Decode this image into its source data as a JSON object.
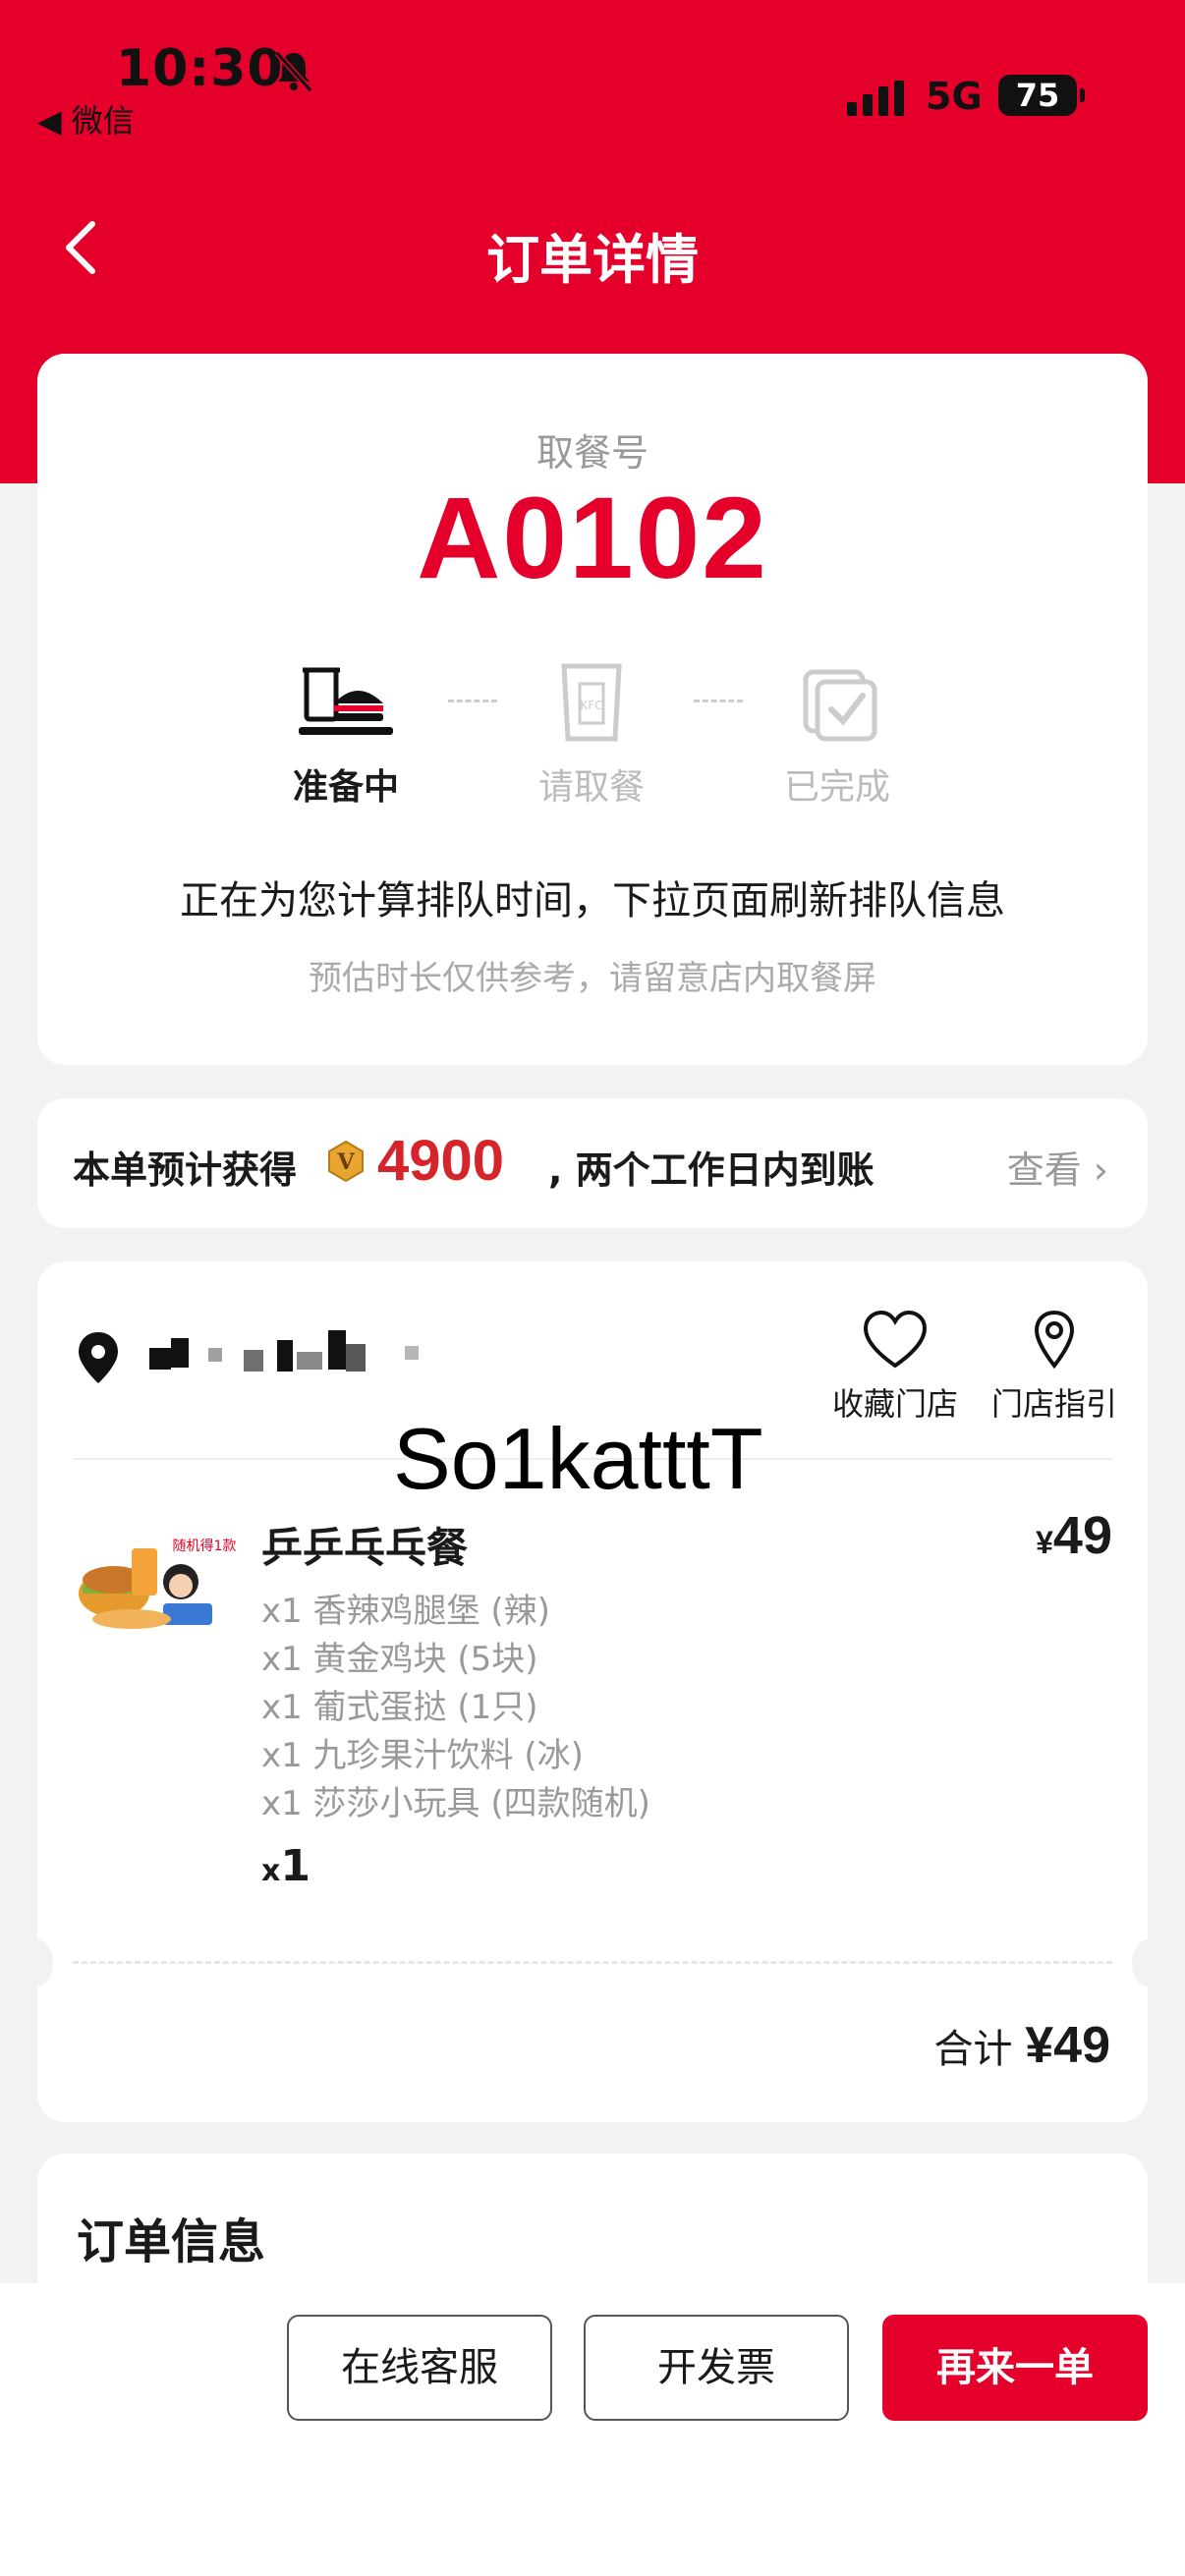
{
  "status_bar": {
    "time": "10:30",
    "back_app": "◀ 微信",
    "network": "5G",
    "battery": "75"
  },
  "nav": {
    "title": "订单详情"
  },
  "pickup": {
    "label": "取餐号",
    "number": "A0102",
    "steps": [
      {
        "label": "准备中",
        "icon": "burger-tray-icon",
        "active": true
      },
      {
        "label": "请取餐",
        "icon": "kfc-bag-icon",
        "active": false
      },
      {
        "label": "已完成",
        "icon": "check-cup-icon",
        "active": false
      }
    ],
    "queue_main": "正在为您计算排队时间，下拉页面刷新排队信息",
    "queue_sub": "预估时长仅供参考，请留意店内取餐屏"
  },
  "points": {
    "prefix": "本单预计获得",
    "coin_glyph": "V",
    "value": "4900",
    "suffix": ", 两个工作日内到账",
    "view": "查看"
  },
  "store": {
    "favorite_label": "收藏门店",
    "guide_label": "门店指引",
    "watermark": "So1katttT"
  },
  "product": {
    "image_label": "随机得1款",
    "name": "乒乒乓乓餐",
    "currency": "¥",
    "price": "49",
    "items": [
      "x1 香辣鸡腿堡 (辣)",
      "x1 黄金鸡块 (5块)",
      "x1 葡式蛋挞 (1只)",
      "x1 九珍果汁饮料 (冰)",
      "x1 莎莎小玩具 (四款随机)"
    ],
    "qty_prefix": "x",
    "qty": "1"
  },
  "total": {
    "label": "合计",
    "amount": "¥49"
  },
  "order_info": {
    "title": "订单信息"
  },
  "actions": {
    "service": "在线客服",
    "invoice": "开发票",
    "reorder": "再来一单"
  },
  "colors": {
    "brand_red": "#e4002b",
    "points_red": "#d5252a"
  }
}
